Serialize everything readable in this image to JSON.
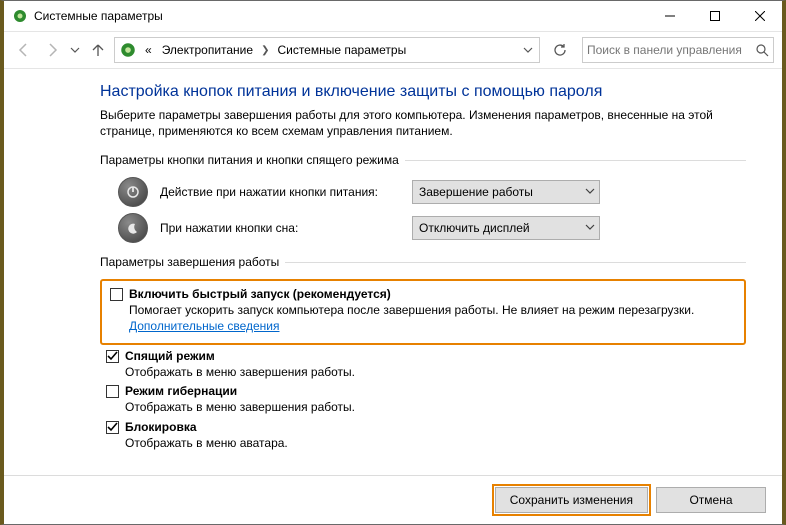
{
  "window": {
    "title": "Системные параметры"
  },
  "breadcrumb": {
    "root_symbol": "«",
    "seg1": "Электропитание",
    "seg2": "Системные параметры"
  },
  "search": {
    "placeholder": "Поиск в панели управления"
  },
  "page": {
    "heading": "Настройка кнопок питания и включение защиты с помощью пароля",
    "description": "Выберите параметры завершения работы для этого компьютера. Изменения параметров, внесенные на этой странице, применяются ко всем схемам управления питанием."
  },
  "sectionA": {
    "label": "Параметры кнопки питания и кнопки спящего режима",
    "row1": {
      "label": "Действие при нажатии кнопки питания:",
      "value": "Завершение работы"
    },
    "row2": {
      "label": "При нажатии кнопки сна:",
      "value": "Отключить дисплей"
    }
  },
  "sectionB": {
    "label": "Параметры завершения работы",
    "opt1": {
      "checked": false,
      "title": "Включить быстрый запуск (рекомендуется)",
      "sub_a": "Помогает ускорить запуск компьютера после завершения работы. Не влияет на режим перезагрузки. ",
      "link": "Дополнительные сведения"
    },
    "opt2": {
      "checked": true,
      "title": "Спящий режим",
      "sub": "Отображать в меню завершения работы."
    },
    "opt3": {
      "checked": false,
      "title": "Режим гибернации",
      "sub": "Отображать в меню завершения работы."
    },
    "opt4": {
      "checked": true,
      "title": "Блокировка",
      "sub": "Отображать в меню аватара."
    }
  },
  "footer": {
    "save": "Сохранить изменения",
    "cancel": "Отмена"
  }
}
